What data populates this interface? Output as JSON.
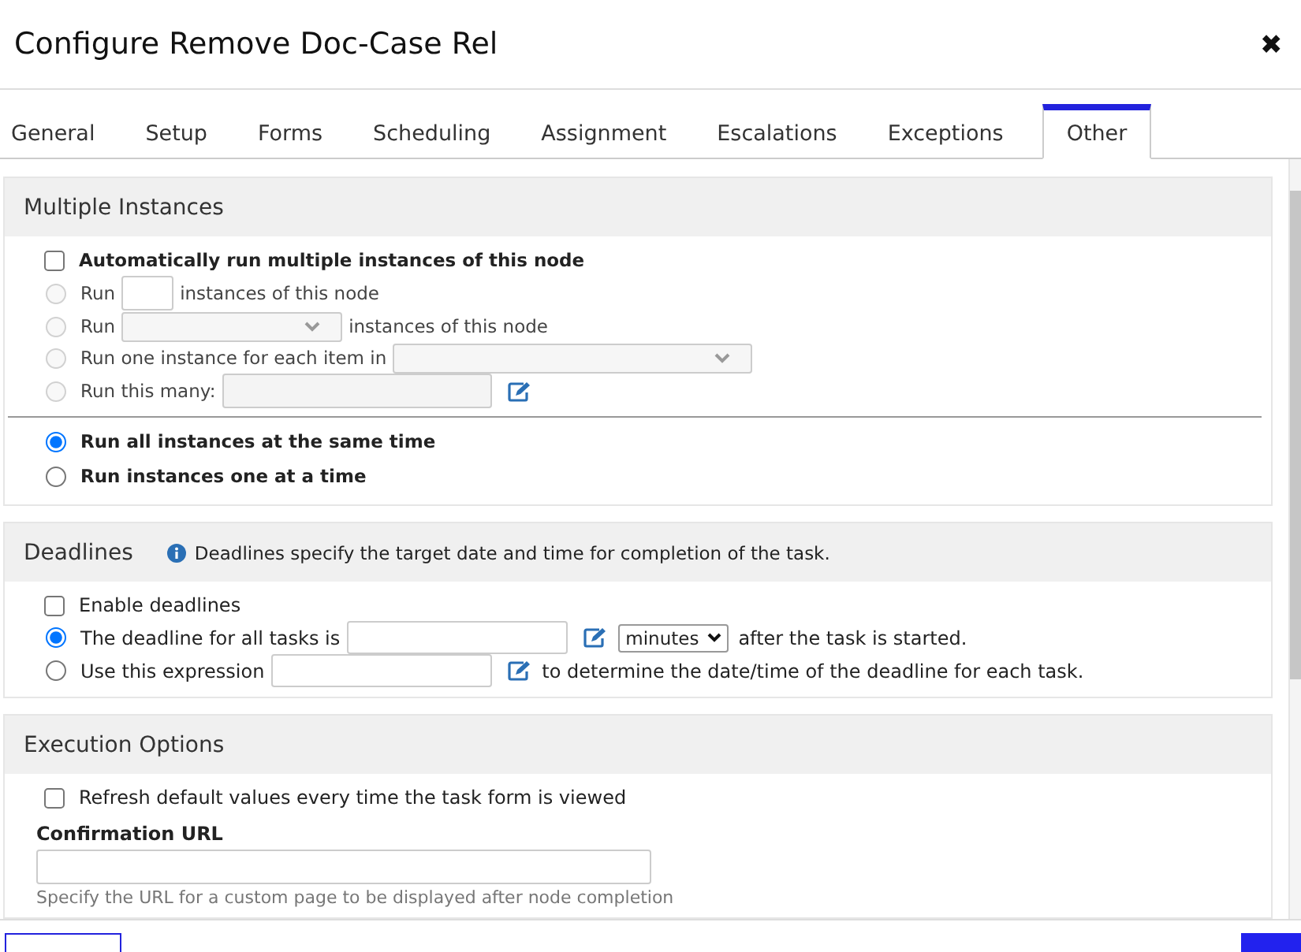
{
  "window": {
    "title": "Configure Remove Doc-Case Rel",
    "close": "✖"
  },
  "tabs": [
    {
      "label": "General",
      "selected": false
    },
    {
      "label": "Setup",
      "selected": false
    },
    {
      "label": "Forms",
      "selected": false
    },
    {
      "label": "Scheduling",
      "selected": false
    },
    {
      "label": "Assignment",
      "selected": false
    },
    {
      "label": "Escalations",
      "selected": false
    },
    {
      "label": "Exceptions",
      "selected": false
    },
    {
      "label": "Other",
      "selected": true
    }
  ],
  "multiple_instances": {
    "title": "Multiple Instances",
    "auto_run": {
      "label": "Automatically run multiple instances of this node",
      "checked": false
    },
    "options": [
      {
        "kind": "number",
        "label": "Run",
        "suffix": "instances of this node",
        "selected": false,
        "disabled": true
      },
      {
        "kind": "select",
        "label": "Run",
        "suffix": "instances of this node",
        "selected": false,
        "disabled": true
      },
      {
        "kind": "list",
        "label": "Run one instance for each item in",
        "selected": false,
        "disabled": true
      },
      {
        "kind": "expression",
        "label": "Run this many:",
        "selected": false,
        "disabled": true
      }
    ],
    "timing": [
      {
        "label": "Run all instances at the same time",
        "selected": true
      },
      {
        "label": "Run instances one at a time",
        "selected": false
      }
    ]
  },
  "deadlines": {
    "title": "Deadlines",
    "info": "Deadlines specify the target date and time for completion of the task.",
    "enable": {
      "label": "Enable deadlines",
      "checked": false
    },
    "options": [
      {
        "kind": "duration",
        "label": "The deadline for all tasks is",
        "unit": "minutes",
        "suffix": "after the task is started.",
        "selected": true
      },
      {
        "kind": "expression",
        "label": "Use this expression",
        "suffix": "to determine the date/time of the deadline for each task.",
        "selected": false
      }
    ]
  },
  "execution_options": {
    "title": "Execution Options",
    "refresh": {
      "label": "Refresh default values every time the task form is viewed",
      "checked": false
    },
    "confirmation_url": {
      "label": "Confirmation URL",
      "hint": "Specify the URL for a custom page to be displayed after node completion"
    }
  }
}
